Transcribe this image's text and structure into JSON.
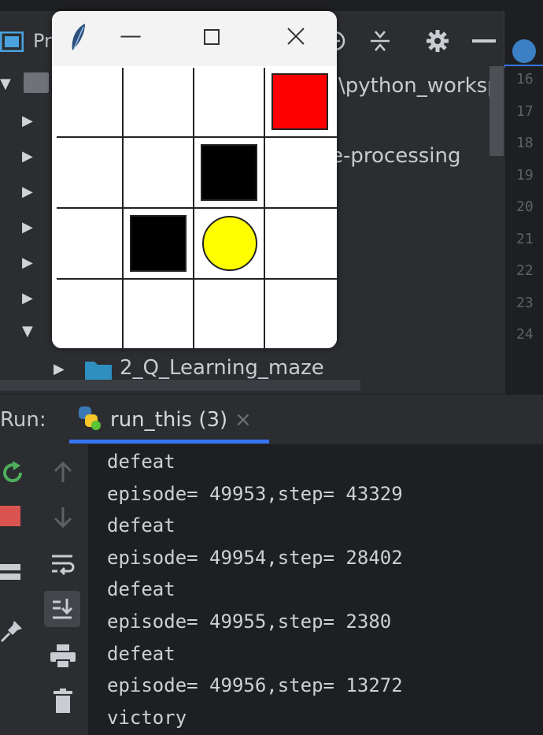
{
  "ide": {
    "project_label": "Pr",
    "tree": {
      "path_fragment": "\\python_worksp",
      "item_processing": "e-processing",
      "item_maze": "2_Q_Learning_maze"
    },
    "line_numbers": [
      "16",
      "17",
      "18",
      "19",
      "20",
      "21",
      "22",
      "23",
      "24"
    ]
  },
  "tk_window": {
    "grid": {
      "rows": 4,
      "cols": 4
    },
    "cells": [
      {
        "row": 0,
        "col": 3,
        "kind": "goal",
        "color": "#ff0000"
      },
      {
        "row": 1,
        "col": 2,
        "kind": "obstacle",
        "color": "#000000"
      },
      {
        "row": 2,
        "col": 1,
        "kind": "obstacle",
        "color": "#000000"
      },
      {
        "row": 2,
        "col": 2,
        "kind": "agent",
        "color": "#ffff00"
      }
    ],
    "icons": [
      "feather-icon",
      "minimize-icon",
      "maximize-icon",
      "close-icon"
    ]
  },
  "run_panel": {
    "label": "Run:",
    "tab_label": "run_this (3)",
    "console_lines": [
      "defeat",
      "episode= 49953,step= 43329",
      "defeat",
      "episode= 49954,step= 28402",
      "defeat",
      "episode= 49955,step= 2380",
      "defeat",
      "episode= 49956,step= 13272",
      "victory"
    ]
  },
  "colors": {
    "accent": "#3574f0",
    "console_bg": "#1e1f22",
    "panel_bg": "#2b2d30"
  }
}
